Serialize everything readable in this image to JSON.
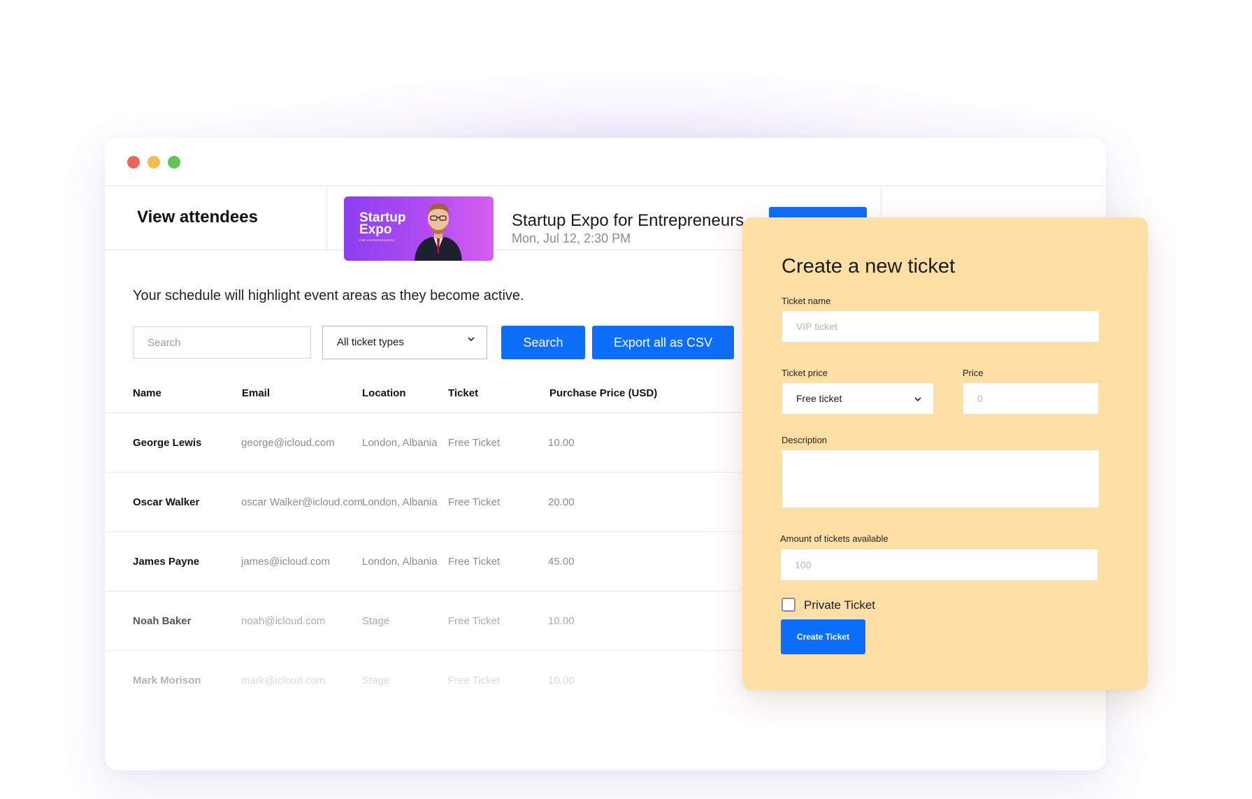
{
  "window_controls": [
    "close-dot",
    "minimize-dot",
    "maximize-dot"
  ],
  "header": {
    "title": "View attendees",
    "event": {
      "thumbnail_title": "Startup Expo",
      "thumbnail_subtitle": "FOR ENTREPRENEURS",
      "title": "Startup Expo for Entrepreneurs",
      "date": "Mon, Jul 12, 2:30 PM"
    }
  },
  "main": {
    "note": "Your schedule will highlight event areas as they become active.",
    "search_placeholder": "Search",
    "filter_selected": "All ticket types",
    "search_button": "Search",
    "export_button": "Export all as CSV",
    "columns": [
      "Name",
      "Email",
      "Location",
      "Ticket",
      "Purchase Price (USD)"
    ],
    "rows": [
      {
        "name": "George Lewis",
        "email": "george@icloud.com",
        "location": "London, Albania",
        "ticket": "Free Ticket",
        "price": "10.00"
      },
      {
        "name": "Oscar Walker",
        "email": "oscar Walker@icloud.com",
        "location": "London, Albania",
        "ticket": "Free Ticket",
        "price": "20.00"
      },
      {
        "name": "James Payne",
        "email": "james@icloud.com",
        "location": "London, Albania",
        "ticket": "Free Ticket",
        "price": "45.00"
      },
      {
        "name": "Noah Baker",
        "email": "noah@icloud.com",
        "location": "Stage",
        "ticket": "Free Ticket",
        "price": "10.00"
      },
      {
        "name": "Mark Morison",
        "email": "mark@icloud.com",
        "location": "Stage",
        "ticket": "Free Ticket",
        "price": "10.00"
      }
    ]
  },
  "panel": {
    "title": "Create a new ticket",
    "ticket_name_label": "Ticket name",
    "ticket_name_placeholder": "VIP ticket",
    "ticket_price_label": "Ticket price",
    "ticket_price_selected": "Free ticket",
    "price_label": "Price",
    "price_placeholder": "0",
    "description_label": "Description",
    "amount_label": "Amount of tickets available",
    "amount_placeholder": "100",
    "private_label": "Private Ticket",
    "private_checked": false,
    "create_button": "Create Ticket"
  },
  "colors": {
    "accent": "#0d6ef9",
    "panel_bg": "#ffdfa3",
    "thumbnail_gradient": [
      "#8a3ff0",
      "#d65ef0"
    ],
    "dot_red": "#ec6559",
    "dot_yellow": "#f3be4f",
    "dot_green": "#61c454"
  },
  "icons": {
    "select_chevron": "chevron-down-icon",
    "speaker_photo": "person-photo"
  }
}
